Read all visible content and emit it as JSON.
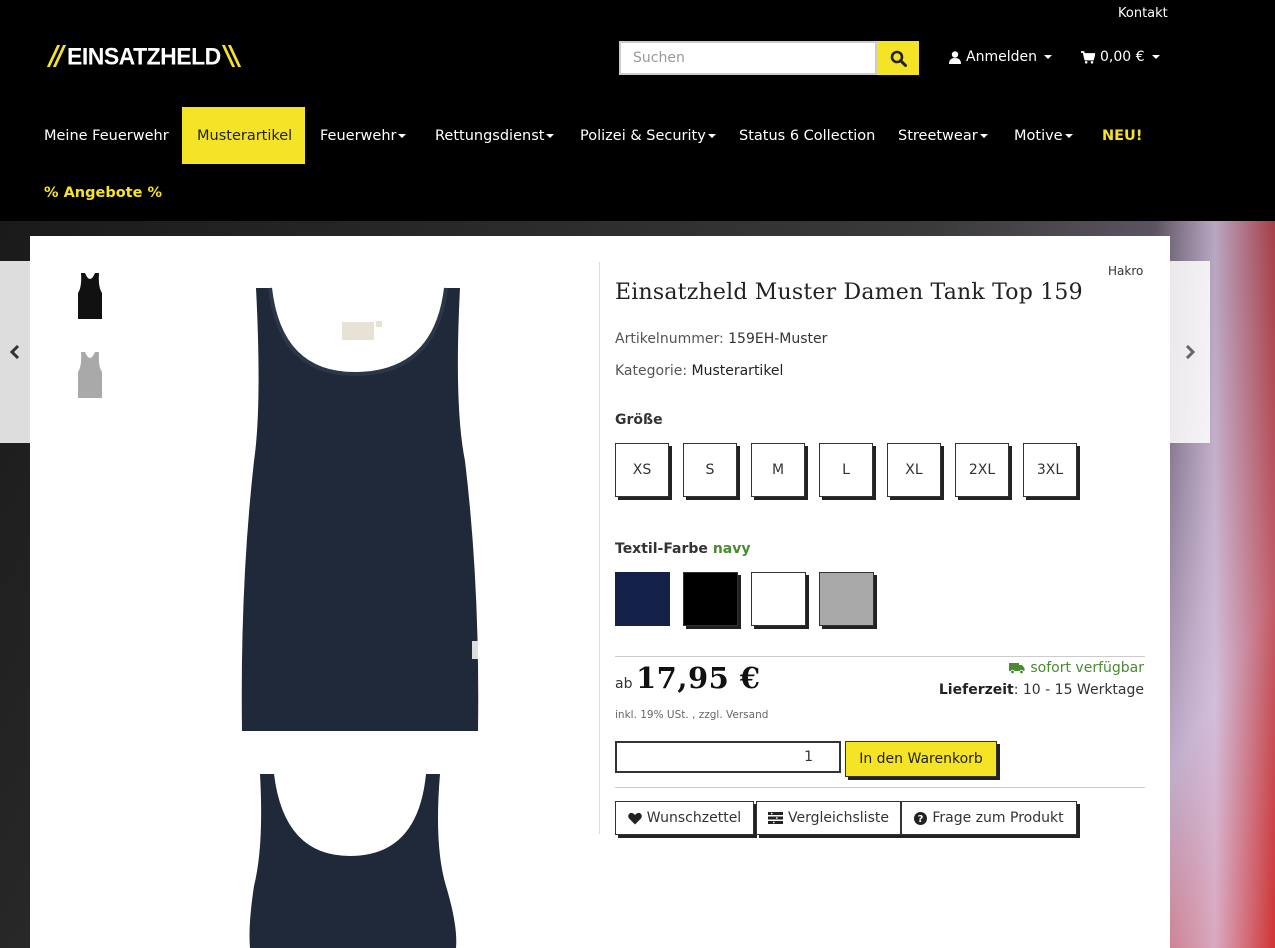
{
  "header": {
    "contact_link": "Kontakt",
    "logo_text": "EINSATZHELD",
    "search": {
      "placeholder": "Suchen"
    },
    "account_label": "Anmelden",
    "cart_total": "0,00 €"
  },
  "nav": {
    "items": [
      {
        "label": "Meine Feuerwehr"
      },
      {
        "label": "Musterartikel"
      },
      {
        "label": "Feuerwehr"
      },
      {
        "label": "Rettungsdienst"
      },
      {
        "label": "Polizei & Security"
      },
      {
        "label": "Status 6 Collection"
      },
      {
        "label": "Streetwear"
      },
      {
        "label": "Motive"
      },
      {
        "label": "NEU!"
      },
      {
        "label": "% Angebote %"
      }
    ]
  },
  "product": {
    "brand": "Hakro",
    "title": "Einsatzheld Muster Damen Tank Top 159",
    "article_number_label": "Artikelnummer:",
    "article_number": "159EH-Muster",
    "category_label": "Kategorie:",
    "category": "Musterartikel",
    "size_label": "Größe",
    "sizes": [
      "XS",
      "S",
      "M",
      "L",
      "XL",
      "2XL",
      "3XL"
    ],
    "color_label": "Textil-Farbe",
    "selected_color": "navy",
    "color_swatches": [
      "#132148",
      "#000000",
      "#ffffff",
      "#a8a8a8"
    ],
    "price_prefix": "ab",
    "price": "17,95 €",
    "tax_note": "inkl. 19% USt. , zzgl. Versand",
    "availability": "sofort verfügbar",
    "delivery_label": "Lieferzeit",
    "delivery_time": ": 10 - 15 Werktage",
    "quantity": "1",
    "add_to_cart": "In den Warenkorb",
    "wishlist": "Wunschzettel",
    "compare": "Vergleichsliste",
    "question": "Frage zum Produkt"
  },
  "colors": {
    "accent": "#f5e325",
    "available_green": "#4a8a30",
    "shirt_navy": "#1e2838"
  }
}
